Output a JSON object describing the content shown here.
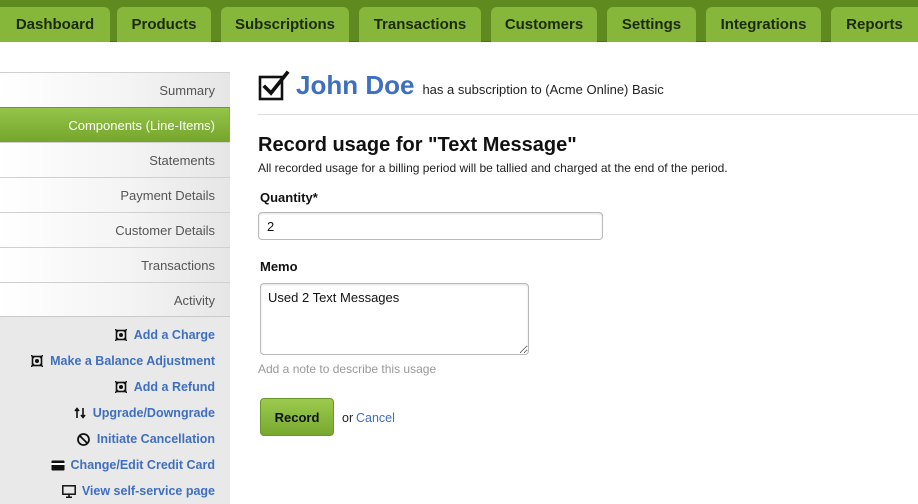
{
  "nav": {
    "tabs": [
      "Dashboard",
      "Products",
      "Subscriptions",
      "Transactions",
      "Customers",
      "Settings",
      "Integrations",
      "Reports"
    ]
  },
  "sidebar": {
    "items": [
      "Summary",
      "Components (Line-Items)",
      "Statements",
      "Payment Details",
      "Customer Details",
      "Transactions",
      "Activity"
    ],
    "active": "Components (Line-Items)",
    "actions": [
      {
        "label": "Add a Charge",
        "icon": "charge-icon"
      },
      {
        "label": "Make a Balance Adjustment",
        "icon": "charge-icon"
      },
      {
        "label": "Add a Refund",
        "icon": "charge-icon"
      },
      {
        "label": "Upgrade/Downgrade",
        "icon": "up-down-arrows-icon"
      },
      {
        "label": "Initiate Cancellation",
        "icon": "cancel-circle-icon"
      },
      {
        "label": "Change/Edit Credit Card",
        "icon": "credit-card-icon"
      },
      {
        "label": "View self-service page",
        "icon": "monitor-icon"
      }
    ]
  },
  "header": {
    "customer_name": "John Doe",
    "subscription_text": "has a subscription to (Acme Online) Basic"
  },
  "form": {
    "title": "Record usage for \"Text Message\"",
    "description": "All recorded usage for a billing period will be tallied and charged at the end of the period.",
    "quantity_label": "Quantity*",
    "quantity_value": "2",
    "memo_label": "Memo",
    "memo_value": "Used 2 Text Messages",
    "memo_hint": "Add a note to describe this usage",
    "record_label": "Record",
    "or_text": "or",
    "cancel_label": "Cancel"
  },
  "colors": {
    "nav_bar": "#5f8a1f",
    "tab": "#86b63a",
    "link": "#3f6fbf",
    "active_item": "#82b139"
  }
}
